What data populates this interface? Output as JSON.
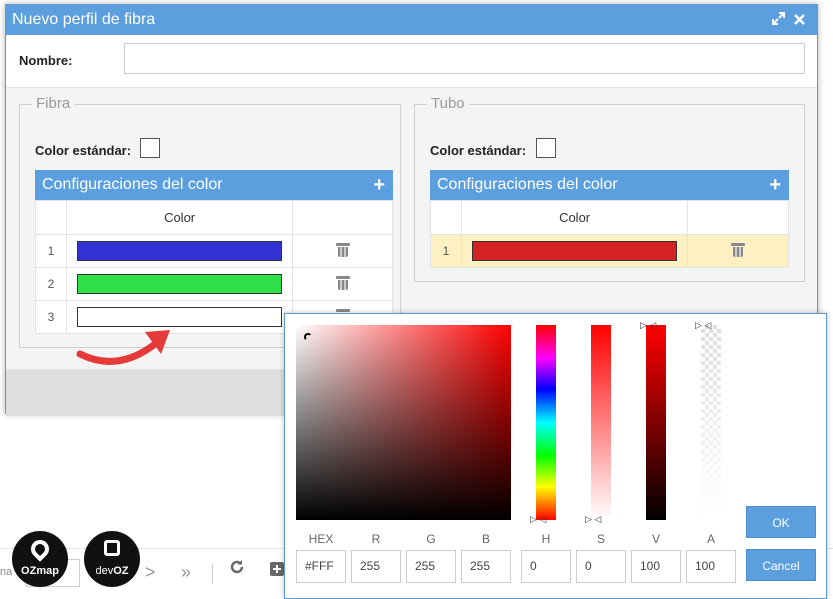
{
  "pager": {
    "label": "na",
    "next_icon": ">",
    "last_icon": "»",
    "refresh_icon": "refresh"
  },
  "logos": {
    "ozmap": "OZmap",
    "devoz_prefix": "dev",
    "devoz_suffix": "OZ"
  },
  "dialog": {
    "title": "Nuevo perfil de fibra",
    "name_label": "Nombre:",
    "name_value": "",
    "fibra": {
      "legend": "Fibra",
      "standard_color_label": "Color estándar:",
      "config_title": "Configuraciones del color",
      "column_color": "Color",
      "rows": [
        {
          "num": "1",
          "color": "#3131d6"
        },
        {
          "num": "2",
          "color": "#2ee14a"
        },
        {
          "num": "3",
          "color": "#ffffff"
        }
      ]
    },
    "tubo": {
      "legend": "Tubo",
      "standard_color_label": "Color estándar:",
      "config_title": "Configuraciones del color",
      "column_color": "Color",
      "rows": [
        {
          "num": "1",
          "color": "#d42121"
        }
      ]
    }
  },
  "picker": {
    "labels": {
      "hex": "HEX",
      "r": "R",
      "g": "G",
      "b": "B",
      "h": "H",
      "s": "S",
      "v": "V",
      "a": "A"
    },
    "values": {
      "hex": "#FFF",
      "r": "255",
      "g": "255",
      "b": "255",
      "h": "0",
      "s": "0",
      "v": "100",
      "a": "100"
    },
    "ok": "OK",
    "cancel": "Cancel"
  }
}
